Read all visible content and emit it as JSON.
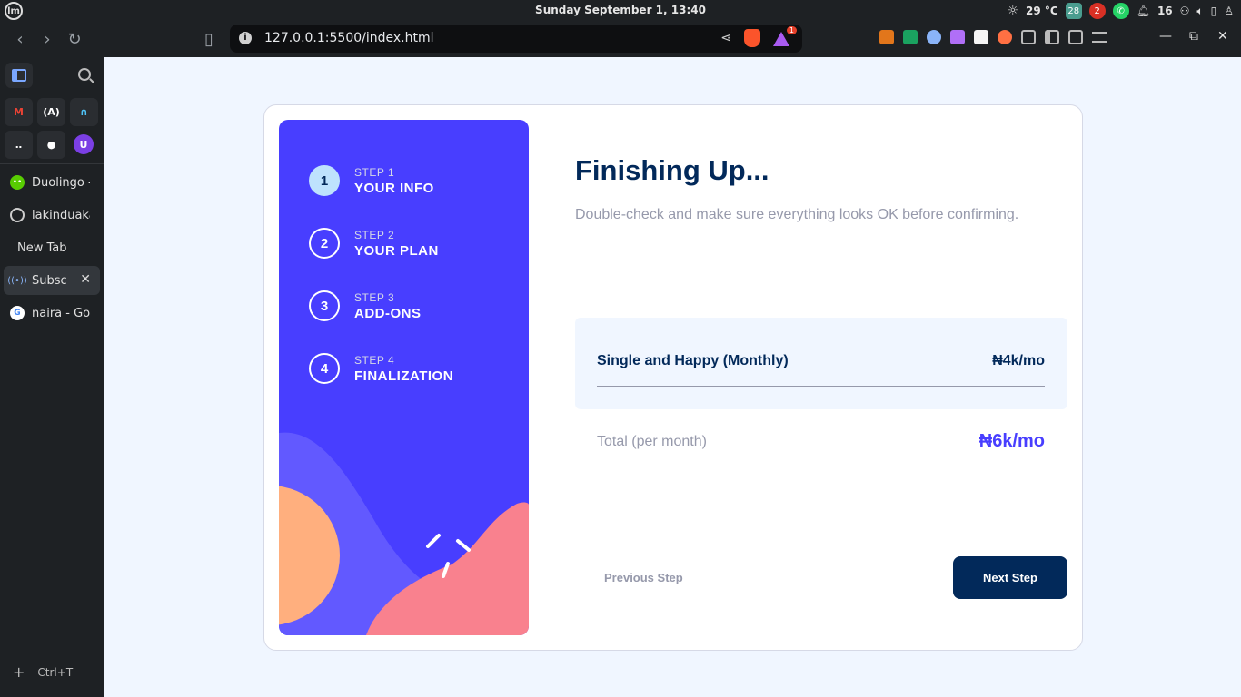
{
  "os": {
    "clock": "Sunday September  1, 13:40",
    "temperature": "29 °C",
    "tray_calendar": "28",
    "tray_count": "16",
    "tray_badge": "2"
  },
  "browser": {
    "url": "127.0.0.1:5500/index.html",
    "rewards_badge": "1",
    "new_tab_hint": "Ctrl+T",
    "tabs": [
      {
        "label": "Duolingo -",
        "icon": "duolingo-icon"
      },
      {
        "label": "lakinduaka",
        "icon": "github-icon"
      },
      {
        "label": "New Tab",
        "icon": ""
      },
      {
        "label": "Subscr",
        "icon": "broadcast-icon",
        "active": true
      },
      {
        "label": "naira - Goo",
        "icon": "google-icon"
      }
    ]
  },
  "steps": [
    {
      "num": "1",
      "label": "STEP 1",
      "title": "YOUR INFO",
      "active": true
    },
    {
      "num": "2",
      "label": "STEP 2",
      "title": "YOUR PLAN",
      "active": false
    },
    {
      "num": "3",
      "label": "STEP 3",
      "title": "ADD-ONS",
      "active": false
    },
    {
      "num": "4",
      "label": "STEP 4",
      "title": "FINALIZATION",
      "active": false
    }
  ],
  "main": {
    "title": "Finishing Up...",
    "subtitle": "Double-check and make sure everything looks OK before confirming.",
    "plan_name": "Single and Happy (Monthly)",
    "plan_price": "₦4k/mo",
    "total_label": "Total (per month)",
    "total_value": "₦6k/mo",
    "prev_label": "Previous Step",
    "next_label": "Next Step"
  },
  "colors": {
    "sidebar_bg": "#483eff",
    "accent": "#483eff",
    "navy": "#02295a",
    "page_bg": "#f0f6ff"
  }
}
